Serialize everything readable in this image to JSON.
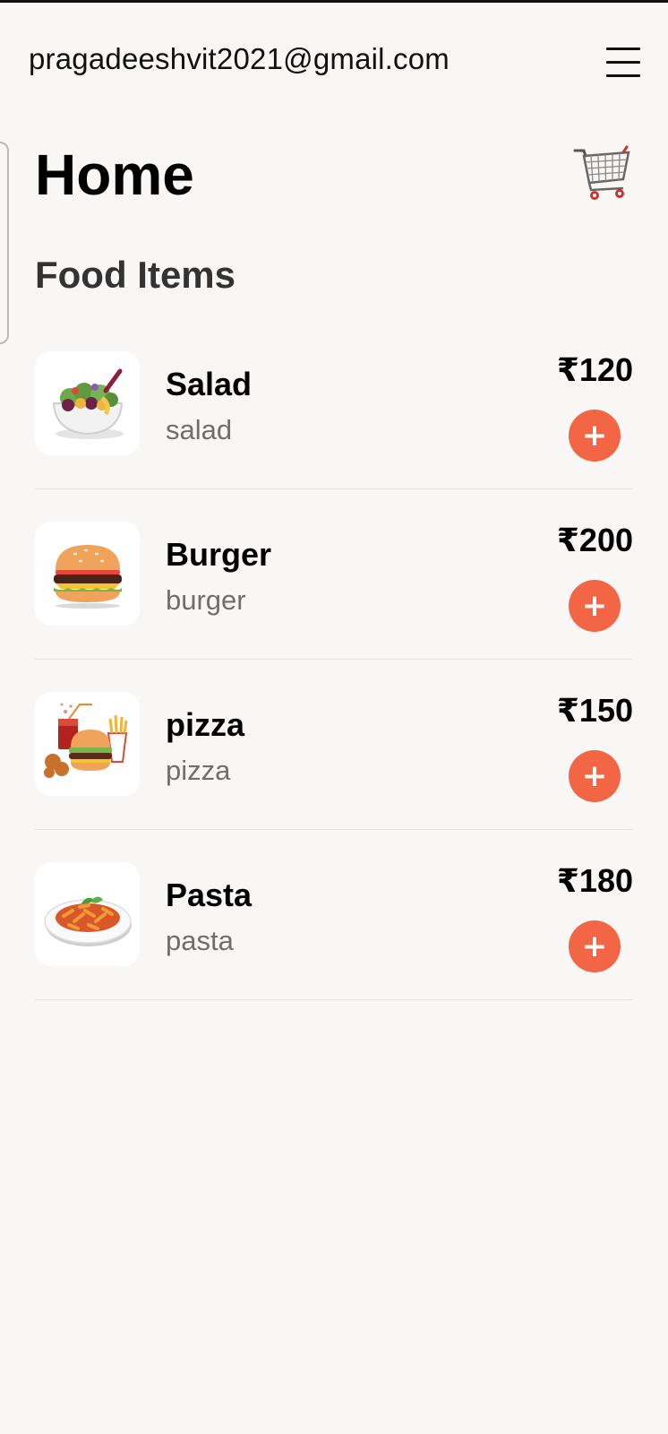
{
  "header": {
    "email": "pragadeeshvit2021@gmail.com",
    "menu_icon": "hamburger-menu-icon"
  },
  "page": {
    "title": "Home",
    "cart_icon": "shopping-cart-icon",
    "section_title": "Food Items"
  },
  "food_items": [
    {
      "name": "Salad",
      "description": "salad",
      "price": "₹120",
      "image": "salad-bowl-image",
      "add_icon": "plus-icon"
    },
    {
      "name": "Burger",
      "description": "burger",
      "price": "₹200",
      "image": "burger-image",
      "add_icon": "plus-icon"
    },
    {
      "name": "pizza",
      "description": "pizza",
      "price": "₹150",
      "image": "fast-food-combo-image",
      "add_icon": "plus-icon"
    },
    {
      "name": "Pasta",
      "description": "pasta",
      "price": "₹180",
      "image": "pasta-plate-image",
      "add_icon": "plus-icon"
    }
  ],
  "colors": {
    "background": "#f8f7f6",
    "add_button": "#f26646",
    "divider": "#e6e4e2",
    "description_text": "#6e6e6e"
  }
}
